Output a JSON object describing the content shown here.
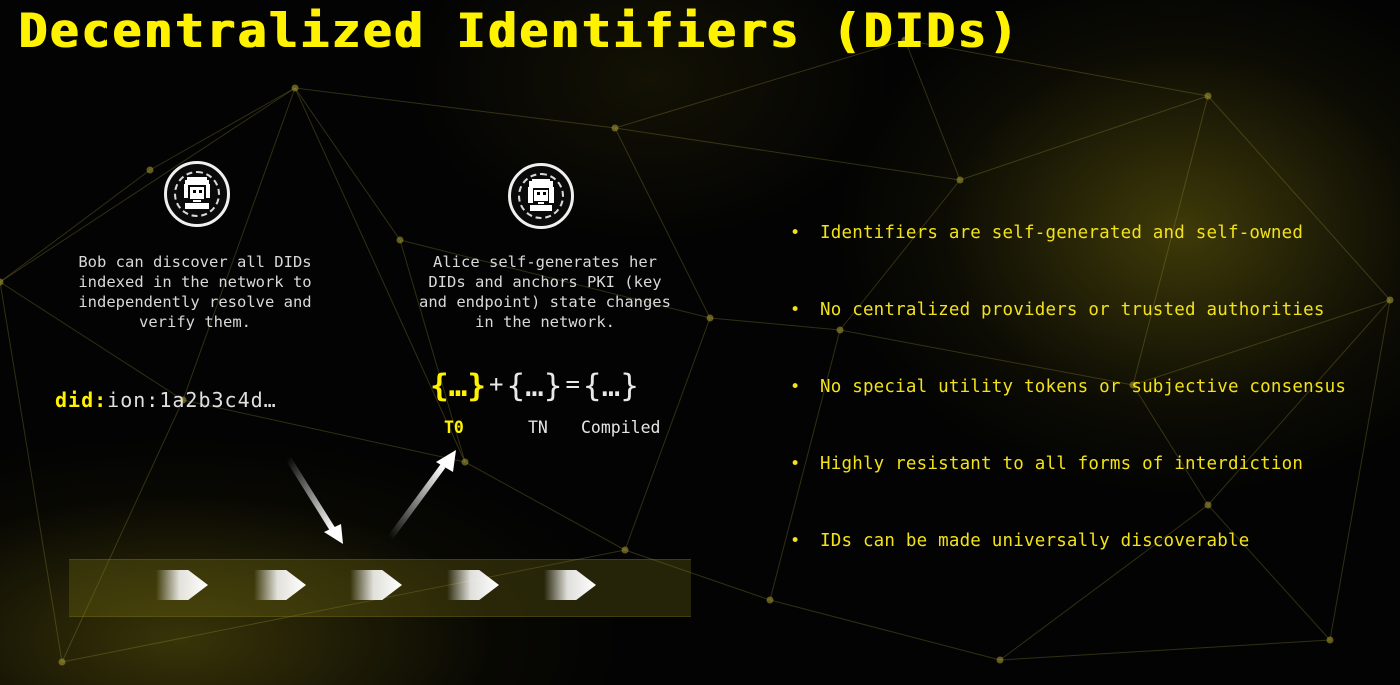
{
  "title": "Decentralized Identifiers (DIDs)",
  "colors": {
    "accent": "#fff200",
    "bullet_text": "#f2e21a",
    "background": "#030303"
  },
  "bob": {
    "icon": "bob-avatar-icon",
    "description": "Bob can discover all DIDs\nindexed in the network to\nindependently resolve and\nverify them."
  },
  "alice": {
    "icon": "alice-avatar-icon",
    "description": "Alice self-generates her\nDIDs and anchors PKI (key\nand endpoint) state changes\nin the network."
  },
  "did_example": {
    "prefix": "did:",
    "rest": "ion:1a2b3c4d…"
  },
  "formula": {
    "box": "{…}",
    "plus": "+",
    "equals": "=",
    "labels": [
      "T0",
      "TN",
      "Compiled"
    ]
  },
  "arrows": {
    "down": "arrow-down-to-network-icon",
    "up": "arrow-up-from-network-icon"
  },
  "network_track": {
    "chevron_count": 5,
    "icon": "chevron-right-icon"
  },
  "bullet_glyph": "•",
  "bullets": [
    "Identifiers are self-generated and self-owned",
    "No centralized providers or trusted authorities",
    "No special utility tokens or subjective consensus",
    "Highly resistant to all forms of interdiction",
    "IDs can be made universally discoverable"
  ]
}
